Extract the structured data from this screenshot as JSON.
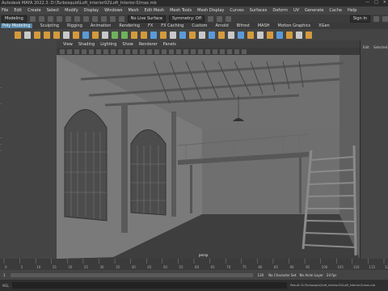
{
  "window": {
    "title": "Autodesk MAYA 2022.3: D:\\Turbosquid\\Loft_interior02\\Loft_Interior.0/max.mb"
  },
  "menubar": {
    "items": [
      "File",
      "Edit",
      "Create",
      "Select",
      "Modify",
      "Display",
      "Windows",
      "Mesh",
      "Edit Mesh",
      "Mesh Tools",
      "Mesh Display",
      "Curves",
      "Surfaces",
      "Deform",
      "UV",
      "Generate",
      "Cache",
      "Help"
    ]
  },
  "statusline": {
    "mode": "Modeling",
    "live_surface": "No Live Surface",
    "symmetry": "Symmetry: Off",
    "signin": "Sign In"
  },
  "shelf": {
    "tabs": [
      "Poly Modeling",
      "Sculpting",
      "Rigging",
      "Animation",
      "Rendering",
      "FX",
      "FX Caching",
      "Custom",
      "Arnold",
      "Bifrost",
      "MASH",
      "Motion Graphics",
      "XGen"
    ]
  },
  "viewport": {
    "menus": [
      "View",
      "Shading",
      "Lighting",
      "Show",
      "Renderer",
      "Panels"
    ],
    "camera_label": "persp"
  },
  "left_panel": {
    "labels": [
      "..",
      "..",
      "..",
      "..",
      ".."
    ]
  },
  "right_panel": {
    "tabs": [
      "Edit",
      "Selected"
    ]
  },
  "timeline": {
    "ticks": [
      "0",
      "5",
      "10",
      "15",
      "20",
      "25",
      "30",
      "35",
      "40",
      "45",
      "50",
      "55",
      "60",
      "65",
      "70",
      "75",
      "80",
      "85",
      "90",
      "95",
      "100",
      "105",
      "110",
      "115",
      "120"
    ]
  },
  "range": {
    "start": "1",
    "end": "120",
    "character_set": "No Character Set",
    "anim_layer": "No Anim Layer",
    "fps": "24 fps"
  },
  "command": {
    "lang": "MEL",
    "status": "Result: D:/Turbosquid/Loft_interior02/Loft_Interior.0/max.mb"
  },
  "colors": {
    "accent": "#5285a6",
    "viewport_bg": "#838383",
    "geometry": "#595959"
  }
}
